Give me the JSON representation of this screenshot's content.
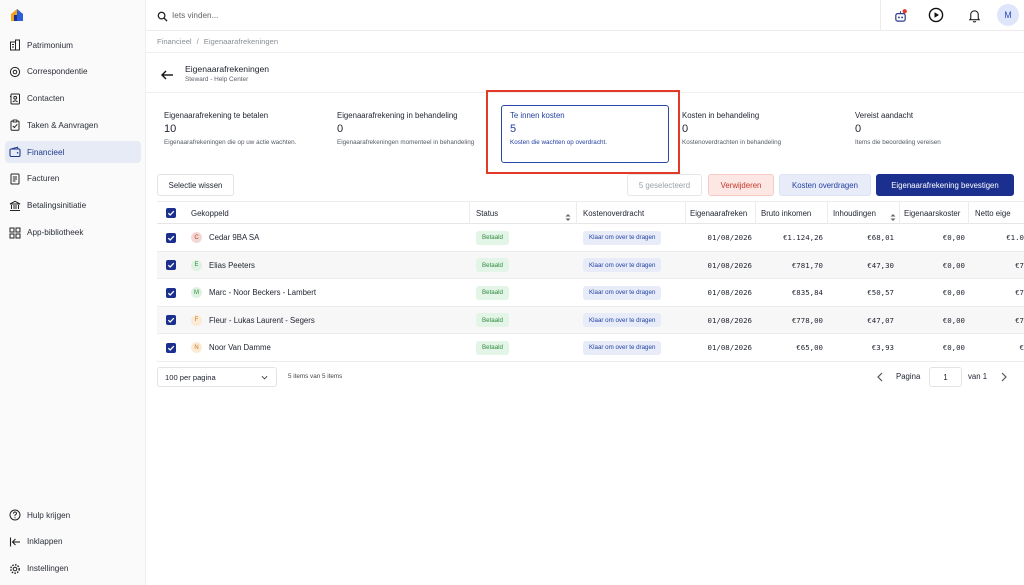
{
  "colors": {
    "accent": "#1b2f8f",
    "active_card_text": "#2341a3",
    "highlight_box": "#e23a27",
    "paid_badge_bg": "#e3f5e6",
    "paid_badge_text": "#2f8a3f",
    "delete_bg": "#fde7e5",
    "delete_text": "#c2372a"
  },
  "sidebar": {
    "logo_icon": "house-logo-icon",
    "items": [
      {
        "label": "Patrimonium",
        "icon": "building-icon",
        "active": false
      },
      {
        "label": "Correspondentie",
        "icon": "at-sign-icon",
        "active": false
      },
      {
        "label": "Contacten",
        "icon": "contacts-book-icon",
        "active": false
      },
      {
        "label": "Taken & Aanvragen",
        "icon": "clipboard-check-icon",
        "active": false
      },
      {
        "label": "Financieel",
        "icon": "wallet-icon",
        "active": true
      },
      {
        "label": "Facturen",
        "icon": "invoice-icon",
        "active": false
      },
      {
        "label": "Betalingsinitiatie",
        "icon": "bank-icon",
        "active": false
      },
      {
        "label": "App-bibliotheek",
        "icon": "grid-icon",
        "active": false
      }
    ],
    "bottom_items": [
      {
        "label": "Hulp krijgen",
        "icon": "help-circle-icon"
      },
      {
        "label": "Inklappen",
        "icon": "collapse-arrow-icon"
      },
      {
        "label": "Instellingen",
        "icon": "gear-icon"
      }
    ]
  },
  "topbar": {
    "search_placeholder": "Iets vinden...",
    "icons": [
      "bot-notification-icon",
      "play-circle-icon",
      "bell-icon"
    ],
    "avatar_initial": "M"
  },
  "breadcrumb": {
    "items": [
      "Financieel",
      "Eigenaarafrekeningen"
    ],
    "separator": "/"
  },
  "header": {
    "title": "Eigenaarafrekeningen",
    "subtitle": "Steward - Help Center"
  },
  "stats": [
    {
      "label": "Eigenaarafrekening te betalen",
      "value": "10",
      "desc": "Eigenaarafrekeningen die op uw actie wachten."
    },
    {
      "label": "Eigenaarafrekening in behandeling",
      "value": "0",
      "desc": "Eigenaarafrekeningen momenteel in behandeling"
    },
    {
      "label": "Te innen kosten",
      "value": "5",
      "desc": "Kosten die wachten op overdracht."
    },
    {
      "label": "Kosten in behandeling",
      "value": "0",
      "desc": "Kostenoverdrachten in behandeling"
    },
    {
      "label": "Vereist aandacht",
      "value": "0",
      "desc": "Items die beoordeling vereisen"
    }
  ],
  "actions": {
    "clear": "Selectie wissen",
    "selected_count": "5 geselecteerd",
    "delete": "Verwijderen",
    "transfer": "Kosten overdragen",
    "confirm": "Eigenaarafrekening bevestigen"
  },
  "table": {
    "headers": {
      "linked": "Gekoppeld",
      "status": "Status",
      "transfer": "Kostenoverdracht",
      "settlement": "Eigenaarafreken",
      "gross": "Bruto inkomen",
      "deductions": "Inhoudingen",
      "owner_costs": "Eigenaarskoster",
      "net": "Netto eige"
    },
    "rows": [
      {
        "initial": "C",
        "initial_color": "#f3d9d6",
        "initial_text": "#c2372a",
        "name": "Cedar 9BA SA",
        "status": "Betaald",
        "transfer": "Klaar om over te dragen",
        "date": "01/08/2026",
        "gross": "€1.124,26",
        "deductions": "€68,01",
        "owner_costs": "€0,00",
        "net": "€1.0"
      },
      {
        "initial": "E",
        "initial_color": "#dff2e2",
        "initial_text": "#2f8a3f",
        "name": "Elias Peeters",
        "status": "Betaald",
        "transfer": "Klaar om over te dragen",
        "date": "01/08/2026",
        "gross": "€781,70",
        "deductions": "€47,30",
        "owner_costs": "€0,00",
        "net": "€7"
      },
      {
        "initial": "M",
        "initial_color": "#dff2e2",
        "initial_text": "#2f8a3f",
        "name": "Marc - Noor Beckers - Lambert",
        "status": "Betaald",
        "transfer": "Klaar om over te dragen",
        "date": "01/08/2026",
        "gross": "€835,84",
        "deductions": "€50,57",
        "owner_costs": "€0,00",
        "net": "€7"
      },
      {
        "initial": "F",
        "initial_color": "#fbead5",
        "initial_text": "#c27a1f",
        "name": "Fleur - Lukas Laurent - Segers",
        "status": "Betaald",
        "transfer": "Klaar om over te dragen",
        "date": "01/08/2026",
        "gross": "€778,00",
        "deductions": "€47,07",
        "owner_costs": "€0,00",
        "net": "€7"
      },
      {
        "initial": "N",
        "initial_color": "#fbead5",
        "initial_text": "#c27a1f",
        "name": "Noor Van Damme",
        "status": "Betaald",
        "transfer": "Klaar om over te dragen",
        "date": "01/08/2026",
        "gross": "€65,00",
        "deductions": "€3,93",
        "owner_costs": "€0,00",
        "net": "€"
      }
    ]
  },
  "footer": {
    "per_page": "100 per pagina",
    "items_info": "5 items van 5 items",
    "page_label": "Pagina",
    "page_value": "1",
    "of_label": "van 1"
  }
}
